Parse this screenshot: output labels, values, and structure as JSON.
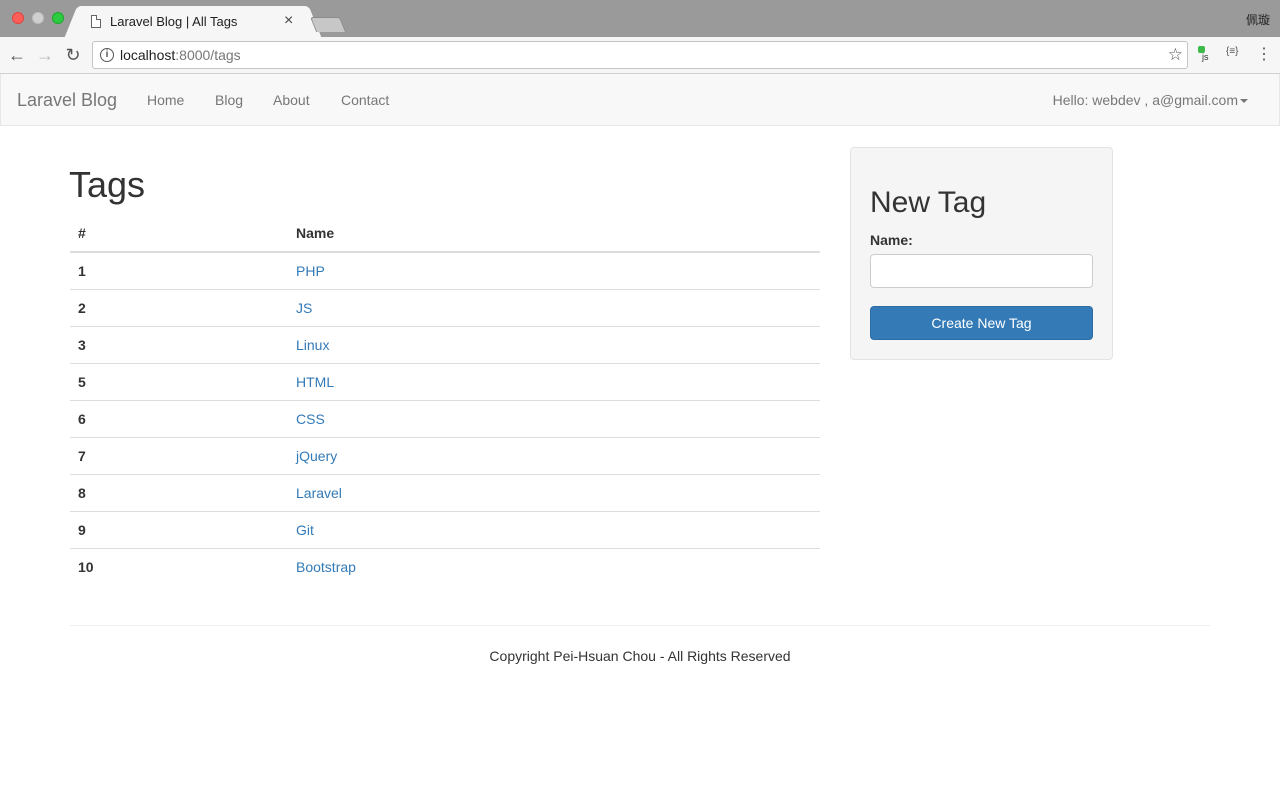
{
  "browser": {
    "tab_title": "Laravel Blog | All Tags",
    "tab_close": "×",
    "profile_name": "佩璇",
    "url_host": "localhost",
    "url_rest": ":8000/tags",
    "ext_js_label": "js",
    "ext_json_label": "{≡}",
    "icons": [
      "back-arrow-icon",
      "forward-arrow-icon",
      "reload-icon",
      "info-icon",
      "star-icon",
      "kebab-menu-icon"
    ]
  },
  "navbar": {
    "brand": "Laravel Blog",
    "links": [
      "Home",
      "Blog",
      "About",
      "Contact"
    ],
    "user": "Hello: webdev , a@gmail.com"
  },
  "main": {
    "title": "Tags",
    "table": {
      "headers": [
        "#",
        "Name"
      ],
      "rows": [
        {
          "id": "1",
          "name": "PHP"
        },
        {
          "id": "2",
          "name": "JS"
        },
        {
          "id": "3",
          "name": "Linux"
        },
        {
          "id": "5",
          "name": "HTML"
        },
        {
          "id": "6",
          "name": "CSS"
        },
        {
          "id": "7",
          "name": "jQuery"
        },
        {
          "id": "8",
          "name": "Laravel"
        },
        {
          "id": "9",
          "name": "Git"
        },
        {
          "id": "10",
          "name": "Bootstrap"
        }
      ]
    }
  },
  "sidebar": {
    "title": "New Tag",
    "name_label": "Name:",
    "name_value": "",
    "submit_label": "Create New Tag"
  },
  "footer": {
    "text": "Copyright Pei-Hsuan Chou - All Rights Reserved"
  },
  "colors": {
    "link": "#337ab7",
    "primary_button": "#337ab7",
    "navbar_bg": "#f8f8f8"
  }
}
